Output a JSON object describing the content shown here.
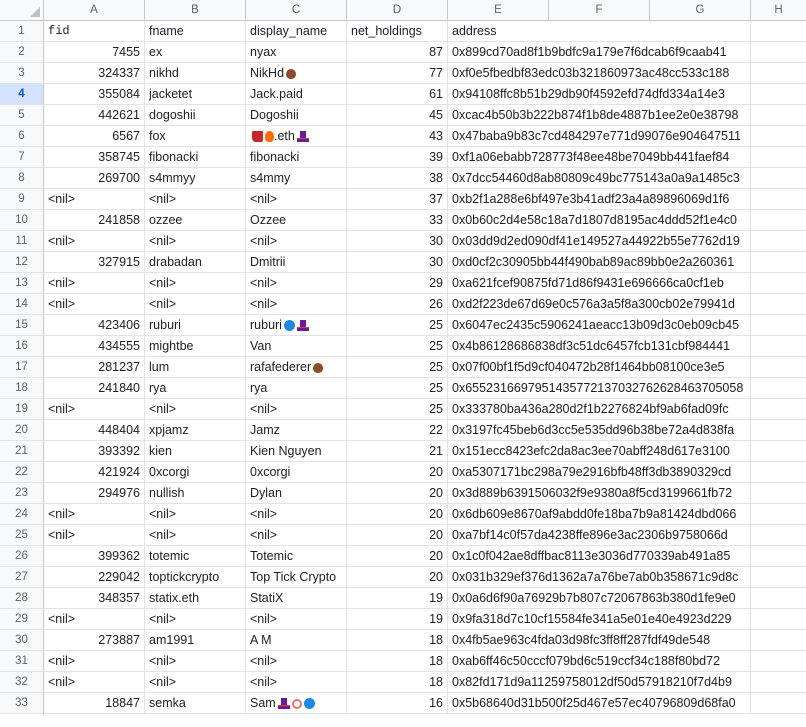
{
  "columns": [
    "A",
    "B",
    "C",
    "D",
    "E",
    "F",
    "G",
    "H"
  ],
  "headers": {
    "a": "fid",
    "b": "fname",
    "c": "display_name",
    "d": "net_holdings",
    "e": "address"
  },
  "rows": [
    {
      "n": "2",
      "fid": "7455",
      "fname": "ex",
      "display": "nyax",
      "icons": [],
      "net": "87",
      "addr": "0x899cd70ad8f1b9bdfc9a179e7f6dcab6f9caab41"
    },
    {
      "n": "3",
      "fid": "324337",
      "fname": "nikhd",
      "display": "NikHd",
      "icons": [
        "nut"
      ],
      "net": "77",
      "addr": "0xf0e5fbedbf83edc03b321860973ac48cc533c188"
    },
    {
      "n": "4",
      "fid": "355084",
      "fname": "jacketet",
      "display": "Jack.paid",
      "icons": [],
      "net": "61",
      "addr": "0x94108ffc8b51b29db90f4592efd74dfd334a14e3"
    },
    {
      "n": "5",
      "fid": "442621",
      "fname": "dogoshii",
      "display": "Dogoshii",
      "icons": [],
      "net": "45",
      "addr": "0xcac4b50b3b222b874f1b8de4887b1ee2e0e38798"
    },
    {
      "n": "6",
      "fid": "6567",
      "fname": "fox",
      "display": ".eth",
      "icons_pre": [
        "boot",
        "fire"
      ],
      "icons": [
        "hat"
      ],
      "net": "43",
      "addr": "0x47baba9b83c7cd484297e771d99076e904647511"
    },
    {
      "n": "7",
      "fid": "358745",
      "fname": "fibonacki",
      "display": "fibonacki",
      "icons": [],
      "net": "39",
      "addr": "0xf1a06ebabb728773f48ee48be7049bb441faef84"
    },
    {
      "n": "8",
      "fid": "269700",
      "fname": "s4mmyy",
      "display": "s4mmy",
      "icons": [],
      "net": "38",
      "addr": "0x7dcc54460d8ab80809c49bc775143a0a9a1485c3"
    },
    {
      "n": "9",
      "fid": "<nil>",
      "fname": "<nil>",
      "display": "<nil>",
      "icons": [],
      "net": "37",
      "addr": "0xb2f1a288e6bf497e3b41adf23a4a89896069d1f6"
    },
    {
      "n": "10",
      "fid": "241858",
      "fname": "ozzee",
      "display": "Ozzee",
      "icons": [],
      "net": "33",
      "addr": "0x0b60c2d4e58c18a7d1807d8195ac4ddd52f1e4c0"
    },
    {
      "n": "11",
      "fid": "<nil>",
      "fname": "<nil>",
      "display": "<nil>",
      "icons": [],
      "net": "30",
      "addr": "0x03dd9d2ed090df41e149527a44922b55e7762d19"
    },
    {
      "n": "12",
      "fid": "327915",
      "fname": "drabadan",
      "display": "Dmitrii",
      "icons": [],
      "net": "30",
      "addr": "0xd0cf2c30905bb44f490bab89ac89bb0e2a260361"
    },
    {
      "n": "13",
      "fid": "<nil>",
      "fname": "<nil>",
      "display": "<nil>",
      "icons": [],
      "net": "29",
      "addr": "0xa621fcef90875fd71d86f9431e696666ca0cf1eb"
    },
    {
      "n": "14",
      "fid": "<nil>",
      "fname": "<nil>",
      "display": "<nil>",
      "icons": [],
      "net": "26",
      "addr": "0xd2f223de67d69e0c576a3a5f8a300cb02e79941d"
    },
    {
      "n": "15",
      "fid": "423406",
      "fname": "ruburi",
      "display": "ruburi",
      "icons": [
        "dot",
        "hat"
      ],
      "net": "25",
      "addr": "0x6047ec2435c5906241aeacc13b09d3c0eb09cb45"
    },
    {
      "n": "16",
      "fid": "434555",
      "fname": "mightbe",
      "display": "Van",
      "icons": [],
      "net": "25",
      "addr": "0x4b86128686838df3c51dc6457fcb131cbf984441"
    },
    {
      "n": "17",
      "fid": "281237",
      "fname": "lum",
      "display": "rafafederer",
      "icons": [
        "nut"
      ],
      "net": "25",
      "addr": "0x07f00bf1f5d9cf040472b28f1464bb08100ce3e5"
    },
    {
      "n": "18",
      "fid": "241840",
      "fname": "rya",
      "display": "rya",
      "icons": [],
      "net": "25",
      "addr": "0x6552316697951435772137032762628463705058"
    },
    {
      "n": "19",
      "fid": "<nil>",
      "fname": "<nil>",
      "display": "<nil>",
      "icons": [],
      "net": "25",
      "addr": "0x333780ba436a280d2f1b2276824bf9ab6fad09fc"
    },
    {
      "n": "20",
      "fid": "448404",
      "fname": "xpjamz",
      "display": "Jamz",
      "icons": [],
      "net": "22",
      "addr": "0x3197fc45beb6d3cc5e535dd96b38be72a4d838fa"
    },
    {
      "n": "21",
      "fid": "393392",
      "fname": "kien",
      "display": "Kien Nguyen",
      "icons": [],
      "net": "21",
      "addr": "0x151ecc8423efc2da8ac3ee70abff248d617e3100"
    },
    {
      "n": "22",
      "fid": "421924",
      "fname": "0xcorgi",
      "display": "0xcorgi",
      "icons": [],
      "net": "20",
      "addr": "0xa5307171bc298a79e2916bfb48ff3db3890329cd"
    },
    {
      "n": "23",
      "fid": "294976",
      "fname": "nullish",
      "display": "Dylan",
      "icons": [],
      "net": "20",
      "addr": "0x3d889b6391506032f9e9380a8f5cd3199661fb72"
    },
    {
      "n": "24",
      "fid": "<nil>",
      "fname": "<nil>",
      "display": "<nil>",
      "icons": [],
      "net": "20",
      "addr": "0x6db609e8670af9abdd0fe18ba7b9a81424dbd066"
    },
    {
      "n": "25",
      "fid": "<nil>",
      "fname": "<nil>",
      "display": "<nil>",
      "icons": [],
      "net": "20",
      "addr": "0xa7bf14c0f57da4238ffe896e3ac2306b9758066d"
    },
    {
      "n": "26",
      "fid": "399362",
      "fname": "totemic",
      "display": "Totemic",
      "icons": [],
      "net": "20",
      "addr": "0x1c0f042ae8dffbac8113e3036d770339ab491a85"
    },
    {
      "n": "27",
      "fid": "229042",
      "fname": "toptickcrypto",
      "display": "Top Tick Crypto",
      "icons": [],
      "net": "20",
      "addr": "0x031b329ef376d1362a7a76be7ab0b358671c9d8c"
    },
    {
      "n": "28",
      "fid": "348357",
      "fname": "statix.eth",
      "display": "StatiX",
      "icons": [],
      "net": "19",
      "addr": "0x0a6d6f90a76929b7b807c72067863b380d1fe9e0"
    },
    {
      "n": "29",
      "fid": "<nil>",
      "fname": "<nil>",
      "display": "<nil>",
      "icons": [],
      "net": "19",
      "addr": "0x9fa318d7c10cf15584fe341a5e01e40e4923d229"
    },
    {
      "n": "30",
      "fid": "273887",
      "fname": "am1991",
      "display": "A M",
      "icons": [],
      "net": "18",
      "addr": "0x4fb5ae963c4fda03d98fc3ff8ff287fdf49de548"
    },
    {
      "n": "31",
      "fid": "<nil>",
      "fname": "<nil>",
      "display": "<nil>",
      "icons": [],
      "net": "18",
      "addr": "0xab6ff46c50cccf079bd6c519ccf34c188f80bd72"
    },
    {
      "n": "32",
      "fid": "<nil>",
      "fname": "<nil>",
      "display": "<nil>",
      "icons": [],
      "net": "18",
      "addr": "0x82fd171d9a11259758012df50d57918210f7d4b9"
    },
    {
      "n": "33",
      "fid": "18847",
      "fname": "semka",
      "display": "Sam",
      "icons": [
        "hat",
        "spiral",
        "dot"
      ],
      "net": "16",
      "addr": "0x5b68640d31b500f25d467e57ec40796809d68fa0"
    }
  ]
}
